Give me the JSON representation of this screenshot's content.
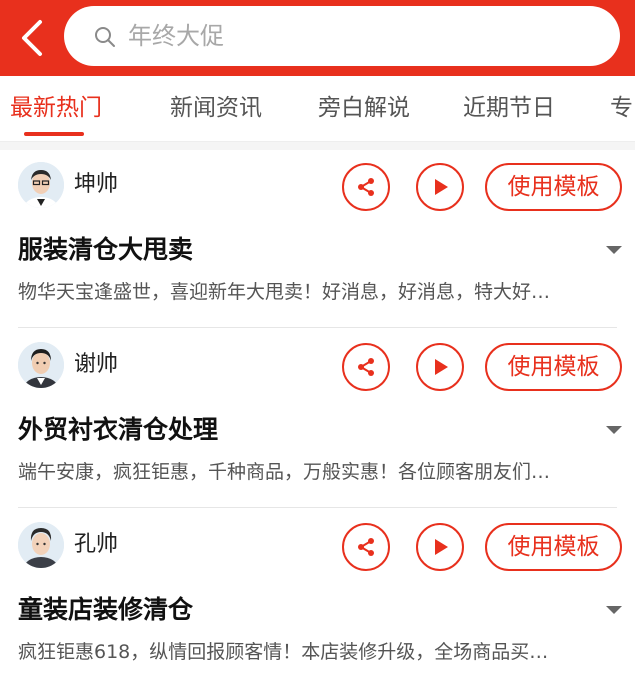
{
  "search": {
    "placeholder": "年终大促"
  },
  "tabs": [
    {
      "label": "最新热门"
    },
    {
      "label": "新闻资讯"
    },
    {
      "label": "旁白解说"
    },
    {
      "label": "近期节日"
    },
    {
      "label": "专"
    }
  ],
  "active_tab": "最新热门",
  "colors": {
    "accent": "#e8301d"
  },
  "cards": [
    {
      "user": "坤帅",
      "use_label": "使用模板",
      "title": "服装清仓大甩卖",
      "desc": "物华天宝逢盛世，喜迎新年大甩卖！好消息，好消息，特大好…"
    },
    {
      "user": "谢帅",
      "use_label": "使用模板",
      "title": "外贸衬衣清仓处理",
      "desc": "端午安康，疯狂钜惠，千种商品，万般实惠！各位顾客朋友们…"
    },
    {
      "user": "孔帅",
      "use_label": "使用模板",
      "title": "童装店装修清仓",
      "desc": "疯狂钜惠618，纵情回报顾客情！本店装修升级，全场商品买…"
    }
  ],
  "icons": [
    "back-arrow-icon",
    "search-icon",
    "share-icon",
    "play-icon",
    "expand-caret-icon"
  ]
}
